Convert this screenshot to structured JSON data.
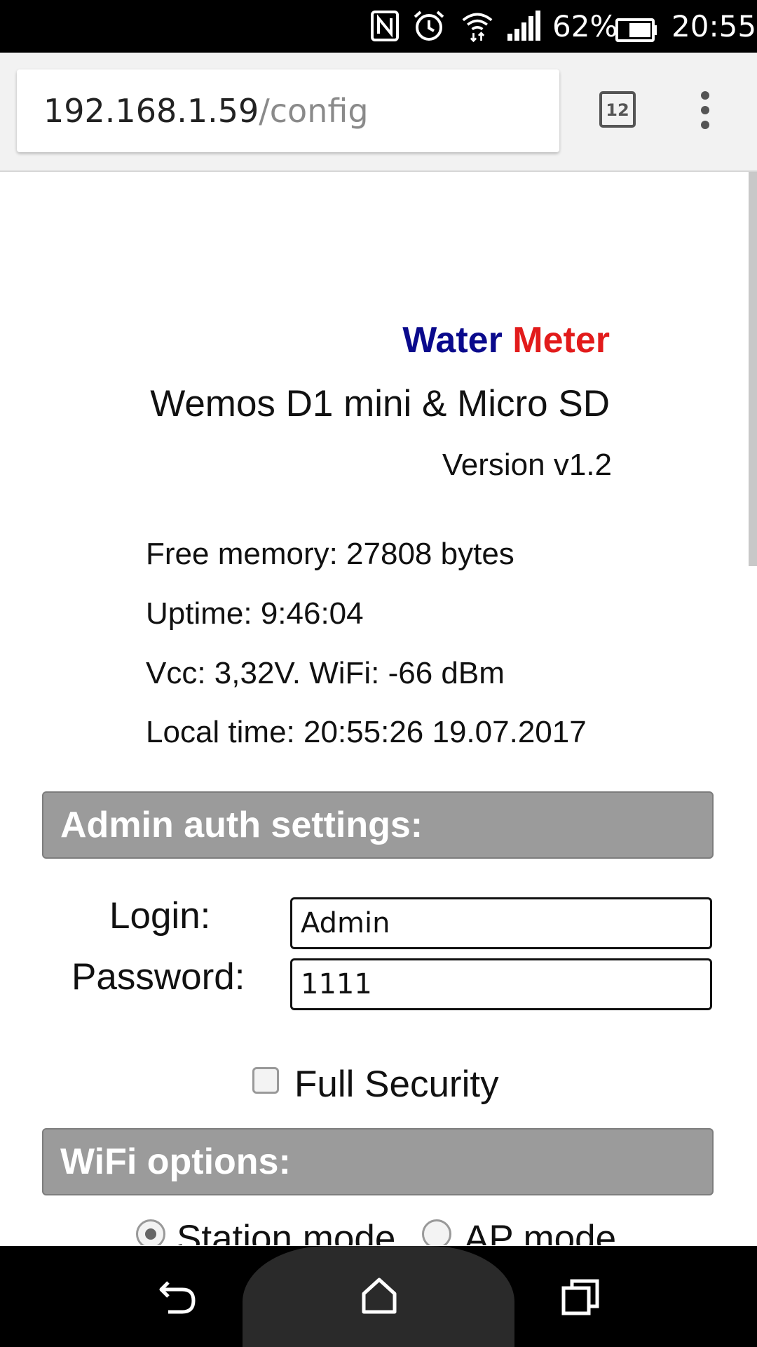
{
  "status_bar": {
    "icons": [
      "nfc-icon",
      "alarm-icon",
      "wifi-icon",
      "signal-icon",
      "battery-icon"
    ],
    "battery_percent": "62%",
    "time": "20:55"
  },
  "browser": {
    "url_host": "192.168.1.59",
    "url_path": "/config",
    "tab_count": "12"
  },
  "page": {
    "title_part1": "Water",
    "title_part2": "Meter",
    "subtitle": "Wemos D1 mini & Micro SD",
    "version": "Version v1.2",
    "info": {
      "free_memory": "Free memory: 27808 bytes",
      "uptime": "Uptime: 9:46:04",
      "vcc_wifi": "Vcc: 3,32V. WiFi: -66 dBm",
      "local_time": "Local time: 20:55:26 19.07.2017"
    },
    "admin_section": {
      "title": "Admin auth settings:",
      "login_label": "Login:",
      "login_value": "Admin",
      "password_label": "Password:",
      "password_value": "1111",
      "full_security_label": "Full Security",
      "full_security_checked": false
    },
    "wifi_section": {
      "title": "WiFi options:",
      "station_label": "Station mode",
      "ap_label": "AP mode",
      "selected_mode": "Station mode"
    }
  },
  "colors": {
    "title_water": "#0a0a8c",
    "title_meter": "#e21b1b",
    "section_bg": "#9b9b9b"
  },
  "nav_bar": {
    "icons": [
      "back-icon",
      "home-icon",
      "recents-icon"
    ]
  }
}
